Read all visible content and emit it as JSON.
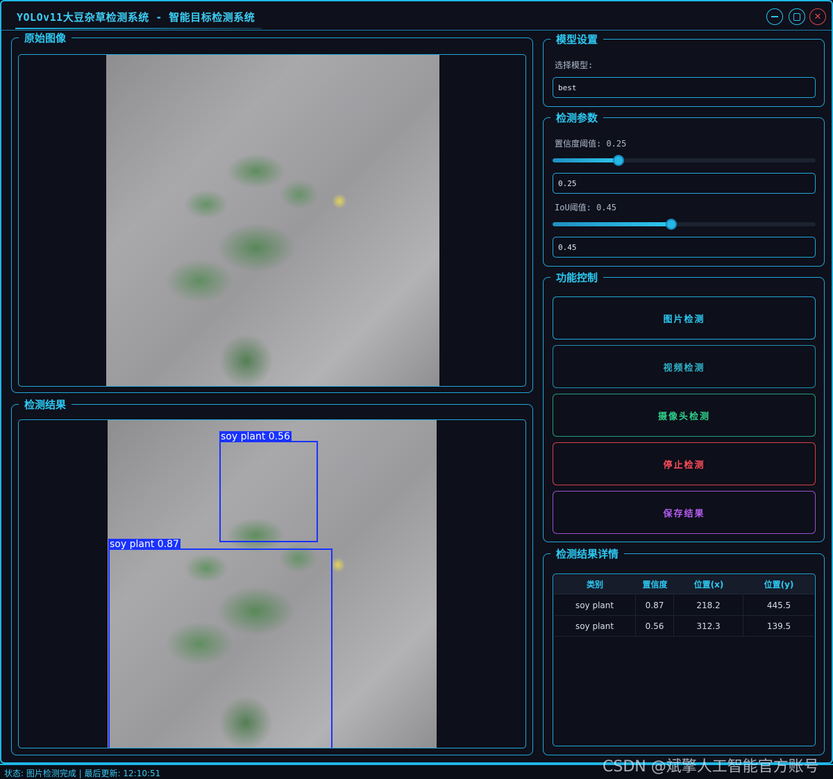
{
  "window": {
    "title": "YOLOv11大豆杂草检测系统 - 智能目标检测系统"
  },
  "panels": {
    "original": {
      "title": "原始图像"
    },
    "result": {
      "title": "检测结果"
    }
  },
  "detections": [
    {
      "label": "soy plant 0.56"
    },
    {
      "label": "soy plant 0.87"
    }
  ],
  "model": {
    "title": "模型设置",
    "select_label": "选择模型:",
    "selected": "best"
  },
  "params": {
    "title": "检测参数",
    "confidence_label": "置信度阈值: 0.25",
    "confidence_value": "0.25",
    "confidence_fraction": 0.25,
    "iou_label": "IoU阈值: 0.45",
    "iou_value": "0.45",
    "iou_fraction": 0.45
  },
  "controls": {
    "title": "功能控制",
    "image_detect": "图片检测",
    "video_detect": "视频检测",
    "camera_detect": "摄像头检测",
    "stop_detect": "停止检测",
    "save_result": "保存结果"
  },
  "details": {
    "title": "检测结果详情",
    "columns": [
      "类别",
      "置信度",
      "位置(x)",
      "位置(y)"
    ],
    "rows": [
      [
        "soy plant",
        "0.87",
        "218.2",
        "445.5"
      ],
      [
        "soy plant",
        "0.56",
        "312.3",
        "139.5"
      ]
    ]
  },
  "status": {
    "text": "状态: 图片检测完成 | 最后更新: 12:10:51"
  },
  "watermark": "CSDN @斌擎人工智能官方账号",
  "colors": {
    "accent": "#2cc9f2",
    "video_btn": "#2fb3c9",
    "camera_btn": "#2fd08a",
    "stop_btn": "#ff4d5a",
    "save_btn": "#b45cf0",
    "detection_box": "#1a33ff"
  }
}
